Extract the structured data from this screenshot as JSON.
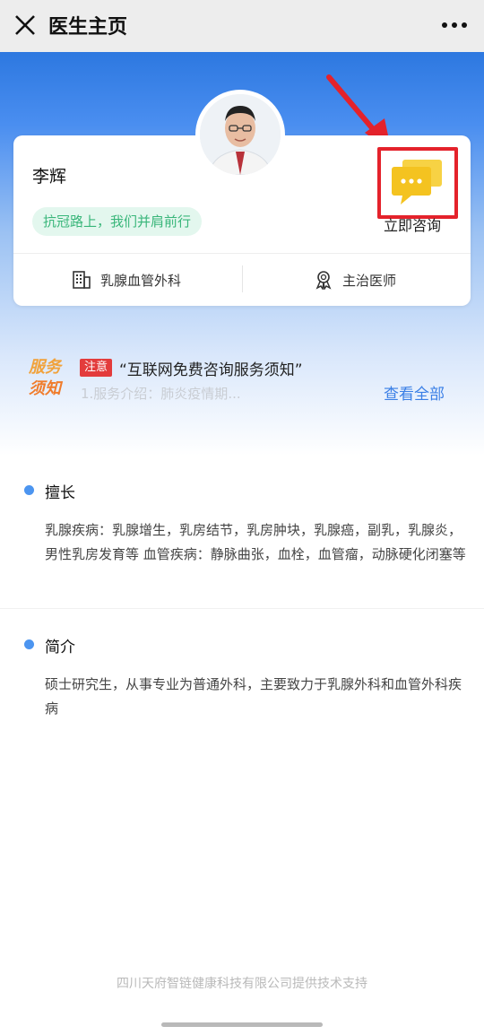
{
  "header": {
    "title": "医生主页"
  },
  "doctor": {
    "name": "李辉",
    "slogan": "抗冠路上，我们并肩前行",
    "consult_label": "立即咨询",
    "department": "乳腺血管外科",
    "role": "主治医师"
  },
  "notice": {
    "badge_line1": "服务",
    "badge_line2": "须知",
    "tag": "注意",
    "title": "“互联网免费咨询服务须知”",
    "subtitle": "1.服务介绍：肺炎疫情期...",
    "view_all": "查看全部"
  },
  "specialty": {
    "title": "擅长",
    "text": "乳腺疾病：乳腺增生，乳房结节，乳房肿块，乳腺癌，副乳，乳腺炎，男性乳房发育等 血管疾病：静脉曲张，血栓，血管瘤，动脉硬化闭塞等"
  },
  "intro": {
    "title": "简介",
    "text": "硕士研究生，从事专业为普通外科，主要致力于乳腺外科和血管外科疾病"
  },
  "footer": {
    "text": "四川天府智链健康科技有限公司提供技术支持"
  },
  "colors": {
    "accent": "#3a7fe6",
    "slogan_green": "#39b67a",
    "alert_red": "#e4222b",
    "chat_yellow": "#f4c320"
  }
}
